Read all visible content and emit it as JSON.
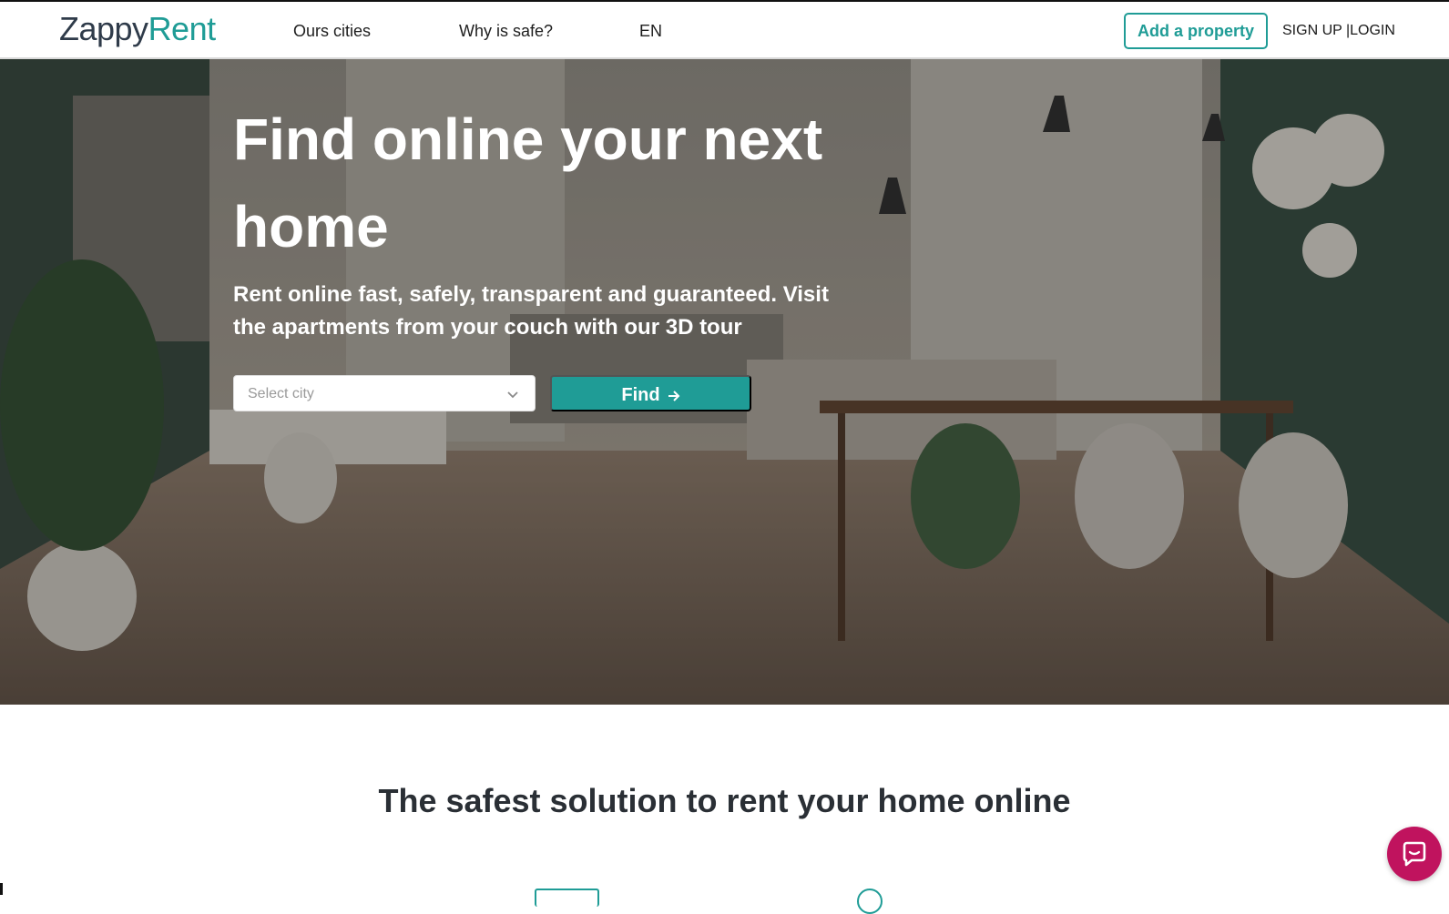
{
  "header": {
    "logo": {
      "part1": "Zappy",
      "part2": "Rent"
    },
    "nav": [
      {
        "label": "Ours cities"
      },
      {
        "label": "Why is safe?"
      },
      {
        "label": "EN"
      }
    ],
    "add_property_label": "Add a property",
    "auth_label": "SIGN UP |LOGIN"
  },
  "hero": {
    "title": "Find online your next home",
    "subtitle": "Rent online fast, safely, transparent and guaranteed. Visit the apartments from your couch with our 3D tour",
    "city_select": {
      "placeholder": "Select city",
      "value": ""
    },
    "find_label": "Find"
  },
  "section": {
    "title": "The safest solution to rent your home online"
  },
  "chat": {
    "icon": "chat-bubble-icon"
  },
  "colors": {
    "accent": "#1f9c96",
    "logo_dark": "#2f3b4a",
    "chat": "#c0135e",
    "text_dark": "#2a2f35"
  }
}
